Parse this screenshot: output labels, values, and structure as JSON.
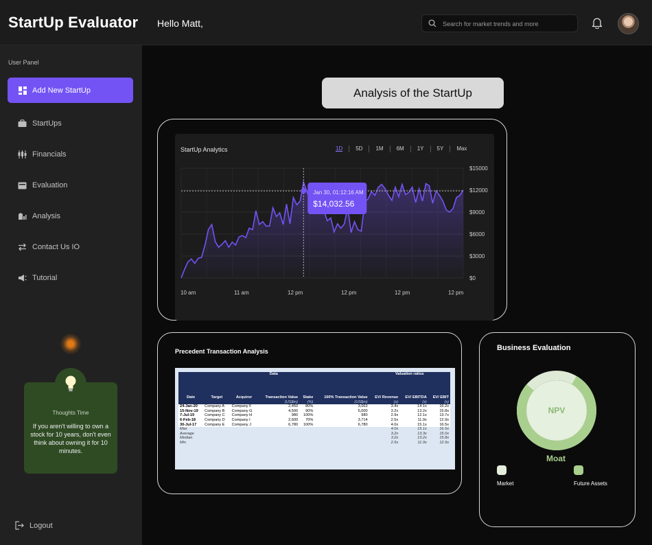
{
  "header": {
    "app_title": "StartUp Evaluator",
    "greeting": "Hello Matt,",
    "search_placeholder": "Search for market trends and more"
  },
  "sidebar": {
    "panel_label": "User Panel",
    "primary_button": "Add New StartUp",
    "items": [
      {
        "label": "StartUps",
        "icon": "briefcase-icon"
      },
      {
        "label": "Financials",
        "icon": "financials-icon"
      },
      {
        "label": "Evaluation",
        "icon": "card-icon"
      },
      {
        "label": "Analysis",
        "icon": "analysis-icon"
      },
      {
        "label": "Contact Us IO",
        "icon": "swap-arrows-icon"
      },
      {
        "label": "Tutorial",
        "icon": "megaphone-icon"
      }
    ],
    "thought": {
      "title": "Thoughts Time",
      "text": "If you aren't willing to own a stock for 10 years, don't even think about owning it for 10 minutes."
    },
    "logout": "Logout"
  },
  "main": {
    "section_title": "Analysis of the StartUp"
  },
  "analytics": {
    "title": "StartUp Analytics",
    "ranges": [
      "1D",
      "5D",
      "1M",
      "6M",
      "1Y",
      "5Y",
      "Max"
    ],
    "active_range": "1D",
    "tooltip": {
      "time": "Jan 30, 01:12:16 AM",
      "value": "$14,032.56"
    }
  },
  "chart_data": {
    "type": "line",
    "x_labels": [
      "10 am",
      "11 am",
      "12 pm",
      "12 pm",
      "12 pm",
      "12 pm"
    ],
    "ylim": [
      0,
      15000
    ],
    "y_ticks": [
      "$0",
      "$3000",
      "$6000",
      "$9000",
      "$12000",
      "$15000"
    ],
    "y_tick_values": [
      0,
      3000,
      6000,
      9000,
      12000,
      15000
    ],
    "grid": true,
    "accent_color": "#7453f5",
    "values": [
      0,
      1200,
      2200,
      2600,
      2000,
      2700,
      2800,
      4500,
      6600,
      7300,
      5000,
      4200,
      4600,
      5100,
      4200,
      4900,
      4500,
      5600,
      5800,
      5500,
      6800,
      6600,
      9200,
      7300,
      7700,
      7100,
      7100,
      9600,
      8400,
      8900,
      7300,
      10100,
      7400,
      11000,
      10000,
      10500,
      13100,
      11800,
      10500,
      11600,
      12100,
      9500,
      9200,
      7800,
      8200,
      6300,
      7400,
      6800,
      7400,
      9600,
      6200,
      7700,
      6600,
      6400,
      10400,
      10800,
      11800,
      11300,
      12400,
      12800,
      12200,
      11300,
      10600,
      12400,
      11100,
      12800,
      11400,
      11700,
      12400,
      10300,
      12200,
      10500,
      12900,
      12600,
      10200,
      11900,
      11300,
      10500,
      9300,
      9000,
      9500,
      11000,
      11300,
      12000
    ]
  },
  "precedent": {
    "title": "Precedent Transaction Analysis",
    "group_headers": [
      "Data",
      "Valuation ratios"
    ],
    "columns": [
      {
        "label": "Date",
        "unit": ""
      },
      {
        "label": "Target",
        "unit": ""
      },
      {
        "label": "Acquiror",
        "unit": ""
      },
      {
        "label": "Transaction Value",
        "unit": "(US$m)"
      },
      {
        "label": "Stake",
        "unit": "(%)"
      },
      {
        "label": "100% Transaction Value",
        "unit": "(US$m)"
      },
      {
        "label": "EV/ Revenue",
        "unit": "(x)"
      },
      {
        "label": "EV/ EBITDA",
        "unit": "(x)"
      },
      {
        "label": "EV/ EBIT",
        "unit": "(x)"
      }
    ],
    "rows": [
      [
        "24-Jan-20",
        "Company A",
        "Company F",
        "2,450",
        "80%",
        "3,063",
        "3.4x",
        "14.1x",
        "16.2x"
      ],
      [
        "15-Nov-19",
        "Company B",
        "Company G",
        "4,500",
        "90%",
        "5,000",
        "3.2x",
        "13.2x",
        "15.8x"
      ],
      [
        "7-Jul-19",
        "Company C",
        "Company H",
        "980",
        "100%",
        "980",
        "2.9x",
        "12.1x",
        "13.7x"
      ],
      [
        "6-Feb-18",
        "Company D",
        "Company I",
        "2,600",
        "70%",
        "3,714",
        "2.5x",
        "11.9x",
        "12.9x"
      ],
      [
        "30-Jul-17",
        "Company E",
        "Company J",
        "6,780",
        "100%",
        "6,780",
        "4.0x",
        "15.1x",
        "16.5x"
      ]
    ],
    "stats": [
      [
        "Max",
        "4.0x",
        "15.1x",
        "16.5x"
      ],
      [
        "Average",
        "3.2x",
        "13.3x",
        "15.0x"
      ],
      [
        "Median",
        "3.2x",
        "13.2x",
        "15.8x"
      ],
      [
        "Min",
        "2.5x",
        "11.9x",
        "12.9x"
      ]
    ]
  },
  "business": {
    "title": "Business Evaluation",
    "center_label": "NPV",
    "subtitle": "Moat",
    "legend": [
      {
        "label": "Market",
        "color": "#e4eedc"
      },
      {
        "label": "Future Assets",
        "color": "#a9cf8e"
      }
    ],
    "ring_colors": {
      "light": "#dfead6",
      "accent": "#a9cf8e"
    }
  }
}
